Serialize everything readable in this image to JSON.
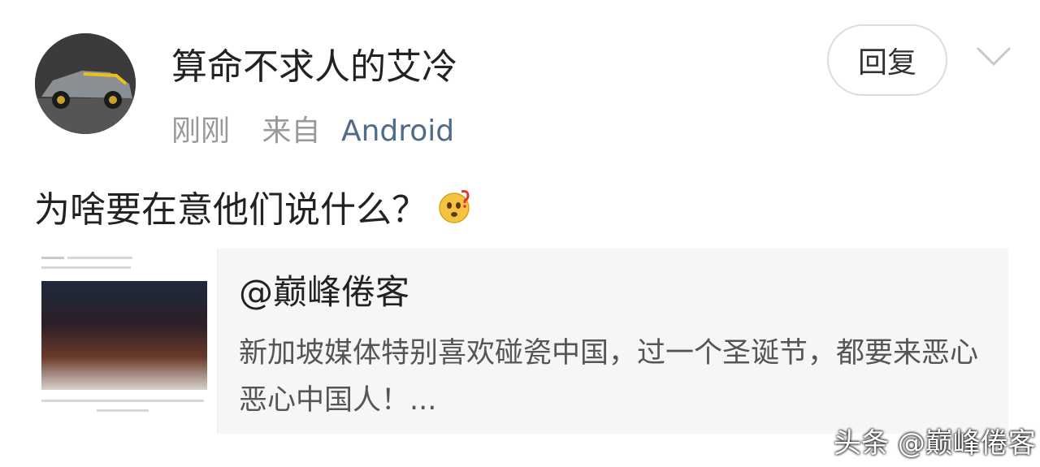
{
  "post": {
    "username": "算命不求人的艾冷",
    "time": "刚刚",
    "source_prefix": "来自",
    "source_app": "Android",
    "reply_label": "回复",
    "content": "为啥要在意他们说什么？",
    "content_emoji": "thinking-face-question-emoji"
  },
  "repost": {
    "author": "@巅峰倦客",
    "text": "新加坡媒体特别喜欢碰瓷中国，过一个圣诞节，都要来恶心恶心中国人！..."
  },
  "watermark": "头条 @巅峰倦客",
  "colors": {
    "link": "#506b8a",
    "secondary_text": "#999999",
    "repost_background": "#f6f6f6"
  },
  "icons": {
    "menu": "chevron-down-icon"
  }
}
